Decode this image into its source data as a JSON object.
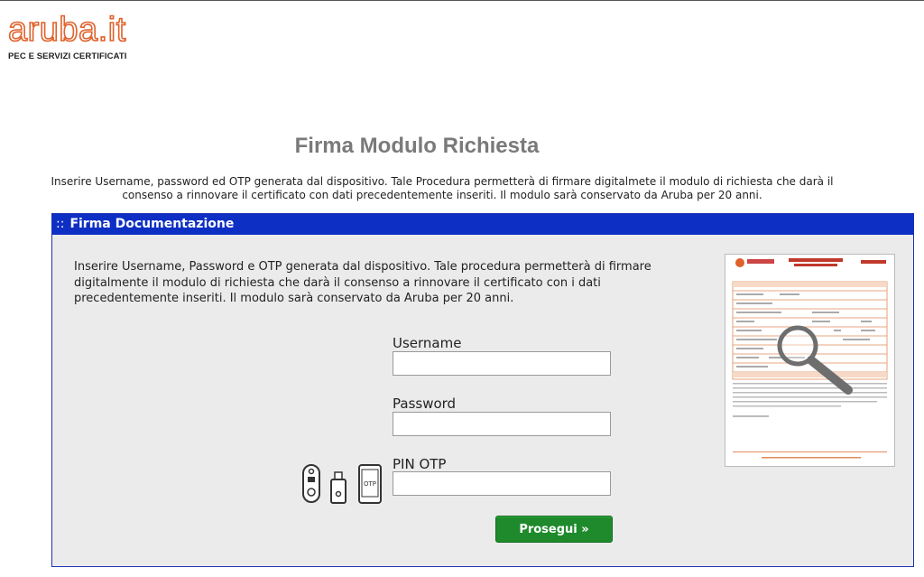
{
  "logo": {
    "wordmark": "aruba.it",
    "tagline": "PEC E SERVIZI CERTIFICATI"
  },
  "page": {
    "title": "Firma Modulo Richiesta",
    "intro": "Inserire Username, password ed OTP generata dal dispositivo. Tale Procedura permetterà di firmare digitalmete il modulo di richiesta che darà il consenso a rinnovare il certificato con dati precedentemente inseriti. Il modulo sarà conservato da Aruba per 20 anni."
  },
  "panel": {
    "header_prefix": "::",
    "header_title": "Firma Documentazione",
    "description": "Inserire Username, Password e OTP generata dal dispositivo. Tale procedura permetterà di firmare digitalmente il modulo di richiesta che darà il consenso a rinnovare il certificato con i dati precedentemente inseriti. Il modulo sarà conservato da Aruba per 20 anni."
  },
  "form": {
    "username_label": "Username",
    "username_value": "",
    "password_label": "Password",
    "password_value": "",
    "otp_label": "PIN OTP",
    "otp_value": "",
    "submit_label": "Prosegui »",
    "otp_device_text": "OTP"
  },
  "document_preview": {
    "icon": "magnifier-icon"
  },
  "colors": {
    "brand_orange": "#e0612b",
    "header_blue": "#0e2fc4",
    "button_green": "#1e8a2c",
    "panel_bg": "#ebebeb"
  }
}
